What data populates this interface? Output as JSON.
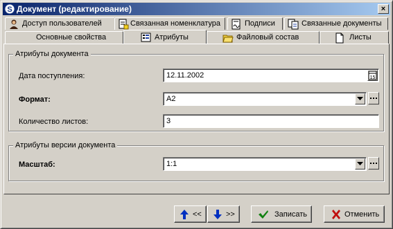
{
  "window": {
    "title": "Документ (редактирование)",
    "close_glyph": "×"
  },
  "tabs_row1": [
    {
      "label": "Доступ пользователей",
      "icon": "user-icon"
    },
    {
      "label": "Связанная номенклатура",
      "icon": "nomenclature-icon"
    },
    {
      "label": "Подписи",
      "icon": "signature-icon"
    },
    {
      "label": "Связанные документы",
      "icon": "linked-docs-icon"
    }
  ],
  "tabs_row2": [
    {
      "label": "Основные свойства",
      "icon": ""
    },
    {
      "label": "Атрибуты",
      "icon": "attributes-icon",
      "active": true
    },
    {
      "label": "Файловый состав",
      "icon": "folder-icon"
    },
    {
      "label": "Листы",
      "icon": "page-icon"
    }
  ],
  "doc_attrs": {
    "legend": "Атрибуты документа",
    "date_label": "Дата поступления:",
    "date_value": "12.11.2002",
    "calendar_glyph": "15",
    "format_label": "Формат:",
    "format_value": "A2",
    "sheets_label": "Количество листов:",
    "sheets_value": "3"
  },
  "version_attrs": {
    "legend": "Атрибуты версии документа",
    "scale_label": "Масштаб:",
    "scale_value": "1:1"
  },
  "buttons": {
    "prev_label": "<<",
    "next_label": ">>",
    "save_label": "Записать",
    "cancel_label": "Отменить"
  },
  "colors": {
    "title_start": "#0a246a",
    "title_end": "#a6caf0",
    "face": "#d4d0c8",
    "arrow_blue": "#0030c0",
    "check_green": "#108010",
    "cross_red": "#c01010"
  }
}
